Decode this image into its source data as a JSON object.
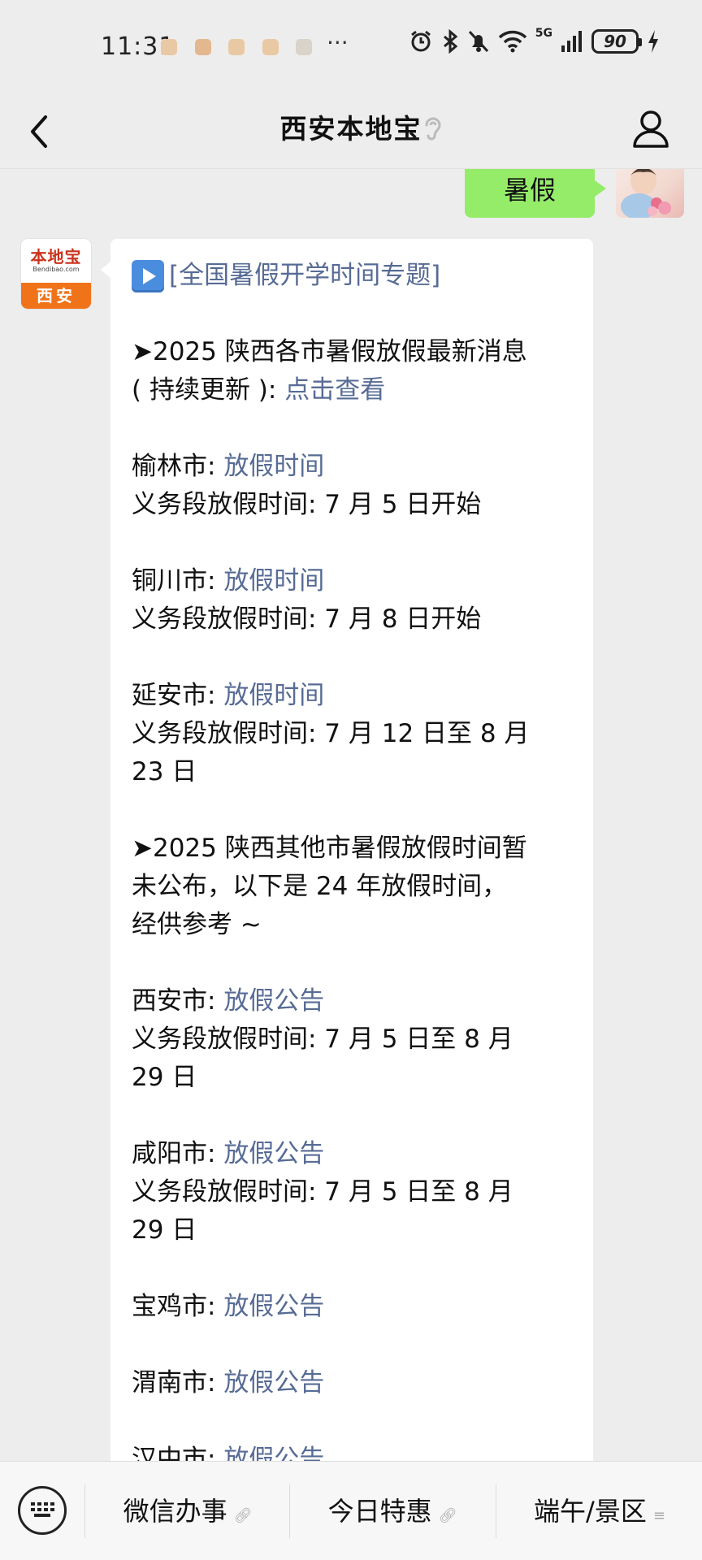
{
  "status_bar": {
    "time": "11:31",
    "more": "···",
    "network": "5G",
    "battery": "90"
  },
  "nav": {
    "title": "西安本地宝"
  },
  "chat": {
    "my_message": "暑假",
    "bot_avatar": {
      "logo_text": "本地宝",
      "logo_sub": "Bendibao.com",
      "city": "西安"
    },
    "article": {
      "topic": "[全国暑假开学时间专题]",
      "intro_1": "➤2025 陕西各市暑假放假最新消息",
      "intro_2": "( 持续更新 ):",
      "intro_link": "点击查看",
      "yulin_city": "榆林市:",
      "yulin_link": "放假时间",
      "yulin_detail": "义务段放假时间: 7 月 5 日开始",
      "tongchuan_city": "铜川市:",
      "tongchuan_link": "放假时间",
      "tongchuan_detail": "义务段放假时间: 7 月 8 日开始",
      "yanan_city": "延安市:",
      "yanan_link": "放假时间",
      "yanan_detail_1": "义务段放假时间: 7 月 12 日至 8 月",
      "yanan_detail_2": "23 日",
      "other_1": "➤2025 陕西其他市暑假放假时间暂",
      "other_2": "未公布，以下是 24 年放假时间，",
      "other_3": "经供参考 ~",
      "xian_city": "西安市:",
      "xian_link": "放假公告",
      "xian_detail_1": "义务段放假时间: 7 月 5 日至 8 月",
      "xian_detail_2": "29 日",
      "xianyang_city": "咸阳市:",
      "xianyang_link": "放假公告",
      "xianyang_detail_1": "义务段放假时间: 7 月 5 日至 8 月",
      "xianyang_detail_2": "29 日",
      "baoji_city": "宝鸡市:",
      "baoji_link": "放假公告",
      "weinan_city": "渭南市:",
      "weinan_link": "放假公告",
      "hanzhong_city": "汉中市:",
      "hanzhong_link": "放假公告"
    }
  },
  "bottom_menu": {
    "items": [
      {
        "label": "微信办事",
        "suffix_icon": "link-icon"
      },
      {
        "label": "今日特惠",
        "suffix_icon": "link-icon"
      },
      {
        "label": "端午/景区",
        "suffix_icon": "menu-lines-icon"
      }
    ]
  },
  "colors": {
    "my_bubble": "#95ec69",
    "link": "#576b95",
    "background": "#ededed",
    "brand_orange": "#f0731a"
  }
}
